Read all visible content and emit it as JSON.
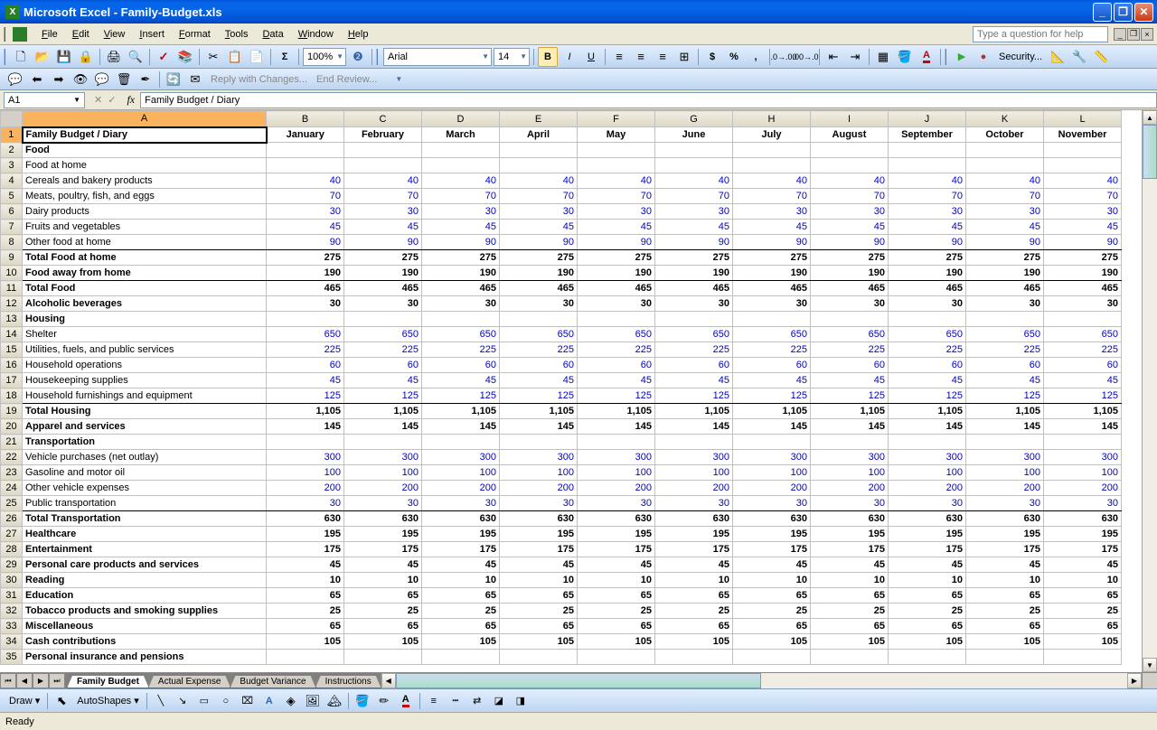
{
  "app": {
    "title": "Microsoft Excel - Family-Budget.xls",
    "help_placeholder": "Type a question for help"
  },
  "menu": [
    "File",
    "Edit",
    "View",
    "Insert",
    "Format",
    "Tools",
    "Data",
    "Window",
    "Help"
  ],
  "toolbar": {
    "zoom": "100%",
    "font": "Arial",
    "size": "14",
    "security": "Security..."
  },
  "review": {
    "reply": "Reply with Changes...",
    "end": "End Review..."
  },
  "namebox": "A1",
  "formula": "Family Budget / Diary",
  "columns": [
    "A",
    "B",
    "C",
    "D",
    "E",
    "F",
    "G",
    "H",
    "I",
    "J",
    "K",
    "L"
  ],
  "months": [
    "January",
    "February",
    "March",
    "April",
    "May",
    "June",
    "July",
    "August",
    "September",
    "October",
    "November"
  ],
  "rows": [
    {
      "r": 1,
      "label": "Family Budget / Diary",
      "type": "title"
    },
    {
      "r": 2,
      "label": "Food",
      "type": "cat"
    },
    {
      "r": 3,
      "label": "Food at home",
      "type": "sub",
      "indent": 1
    },
    {
      "r": 4,
      "label": "Cereals and bakery products",
      "type": "item",
      "indent": 2,
      "val": 40
    },
    {
      "r": 5,
      "label": "Meats, poultry, fish, and eggs",
      "type": "item",
      "indent": 2,
      "val": 70
    },
    {
      "r": 6,
      "label": "Dairy products",
      "type": "item",
      "indent": 2,
      "val": 30
    },
    {
      "r": 7,
      "label": "Fruits and vegetables",
      "type": "item",
      "indent": 2,
      "val": 45
    },
    {
      "r": 8,
      "label": "Other food at home",
      "type": "item",
      "indent": 2,
      "val": 90,
      "bb": true
    },
    {
      "r": 9,
      "label": "Total Food at home",
      "type": "total",
      "indent": 1,
      "val": 275
    },
    {
      "r": 10,
      "label": "Food away from home",
      "type": "totalitem",
      "indent": 1,
      "val": 190,
      "bb": true
    },
    {
      "r": 11,
      "label": "Total Food",
      "type": "total",
      "val": 465
    },
    {
      "r": 12,
      "label": "Alcoholic beverages",
      "type": "totalitem",
      "val": 30,
      "numblue": true
    },
    {
      "r": 13,
      "label": "Housing",
      "type": "cat"
    },
    {
      "r": 14,
      "label": "Shelter",
      "type": "item",
      "indent": 1,
      "val": 650
    },
    {
      "r": 15,
      "label": "Utilities, fuels, and public services",
      "type": "item",
      "indent": 1,
      "val": 225
    },
    {
      "r": 16,
      "label": "Household operations",
      "type": "item",
      "indent": 1,
      "val": 60
    },
    {
      "r": 17,
      "label": "Housekeeping supplies",
      "type": "item",
      "indent": 1,
      "val": 45
    },
    {
      "r": 18,
      "label": "Household furnishings and equipment",
      "type": "item",
      "indent": 1,
      "val": 125,
      "bb": true
    },
    {
      "r": 19,
      "label": "Total Housing",
      "type": "total",
      "val": "1,105"
    },
    {
      "r": 20,
      "label": "Apparel and services",
      "type": "totalitem",
      "val": 145,
      "numblue": true
    },
    {
      "r": 21,
      "label": "Transportation",
      "type": "cat"
    },
    {
      "r": 22,
      "label": "Vehicle purchases (net outlay)",
      "type": "item",
      "indent": 1,
      "val": 300
    },
    {
      "r": 23,
      "label": "Gasoline and motor oil",
      "type": "item",
      "indent": 1,
      "val": 100
    },
    {
      "r": 24,
      "label": "Other vehicle expenses",
      "type": "item",
      "indent": 1,
      "val": 200
    },
    {
      "r": 25,
      "label": "Public transportation",
      "type": "item",
      "indent": 1,
      "val": 30,
      "bb": true
    },
    {
      "r": 26,
      "label": "Total Transportation",
      "type": "total",
      "val": 630
    },
    {
      "r": 27,
      "label": "Healthcare",
      "type": "totalitem",
      "val": 195,
      "numblue": true
    },
    {
      "r": 28,
      "label": "Entertainment",
      "type": "totalitem",
      "val": 175,
      "numblue": true
    },
    {
      "r": 29,
      "label": "Personal care products and services",
      "type": "totalitem",
      "val": 45,
      "numblue": true
    },
    {
      "r": 30,
      "label": "Reading",
      "type": "totalitem",
      "val": 10,
      "numblue": true
    },
    {
      "r": 31,
      "label": "Education",
      "type": "totalitem",
      "val": 65,
      "numblue": true
    },
    {
      "r": 32,
      "label": "Tobacco products and smoking supplies",
      "type": "totalitem",
      "val": 25,
      "numblue": true
    },
    {
      "r": 33,
      "label": "Miscellaneous",
      "type": "totalitem",
      "val": 65,
      "numblue": true
    },
    {
      "r": 34,
      "label": "Cash contributions",
      "type": "totalitem",
      "val": 105,
      "numblue": true
    },
    {
      "r": 35,
      "label": "Personal insurance and pensions",
      "type": "cat"
    }
  ],
  "tabs": [
    "Family Budget",
    "Actual Expense",
    "Budget Variance",
    "Instructions"
  ],
  "active_tab": 0,
  "draw": {
    "label": "Draw",
    "autoshapes": "AutoShapes"
  },
  "status": "Ready"
}
